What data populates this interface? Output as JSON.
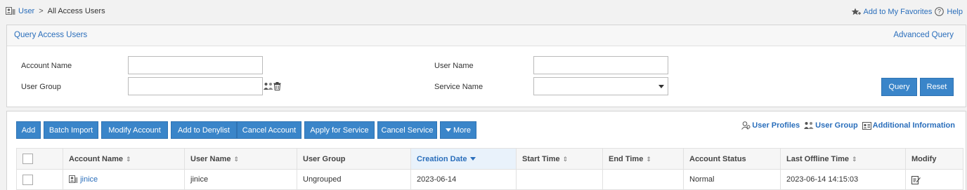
{
  "breadcrumb": {
    "root": "User",
    "separator": ">",
    "current": "All Access Users"
  },
  "top_links": {
    "favorites": "Add to My Favorites",
    "help": "Help"
  },
  "query_panel": {
    "title": "Query Access Users",
    "advanced": "Advanced Query",
    "fields": {
      "account_name": {
        "label": "Account Name",
        "value": ""
      },
      "user_name": {
        "label": "User Name",
        "value": ""
      },
      "user_group": {
        "label": "User Group",
        "value": ""
      },
      "service_name": {
        "label": "Service Name",
        "value": ""
      }
    },
    "buttons": {
      "query": "Query",
      "reset": "Reset"
    }
  },
  "toolbar": {
    "add": "Add",
    "batch_import": "Batch Import",
    "modify_account": "Modify Account",
    "add_to_denylist": "Add to Denylist",
    "cancel_account": "Cancel Account",
    "apply_for_service": "Apply for Service",
    "cancel_service": "Cancel Service",
    "more": "More"
  },
  "tools": {
    "user_profiles": "User Profiles",
    "user_group": "User Group",
    "additional_info": "Additional Information"
  },
  "table": {
    "columns": {
      "account_name": "Account Name",
      "user_name": "User Name",
      "user_group": "User Group",
      "creation_date": "Creation Date",
      "start_time": "Start Time",
      "end_time": "End Time",
      "account_status": "Account Status",
      "last_offline_time": "Last Offline Time",
      "modify": "Modify"
    },
    "rows": [
      {
        "account_name": "jinice",
        "user_name": "jinice",
        "user_group": "Ungrouped",
        "creation_date": "2023-06-14",
        "start_time": "",
        "end_time": "",
        "account_status": "Normal",
        "last_offline_time": "2023-06-14 14:15:03"
      }
    ]
  },
  "colors": {
    "accent": "#2a6ebb",
    "button": "#3a85c9",
    "panel_border": "#d4d4d4"
  }
}
